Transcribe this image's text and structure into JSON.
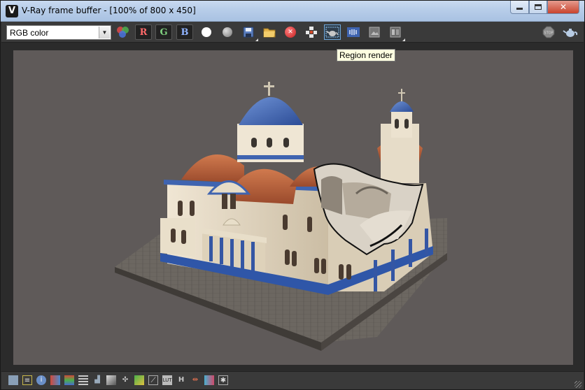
{
  "window": {
    "title": "V-Ray frame buffer - [100% of 800 x 450]",
    "app_icon": "vray-logo-icon"
  },
  "toolbar": {
    "channel_value": "RGB color",
    "buttons": [
      {
        "name": "rgb-channels-button",
        "icon": "rgb-circles-icon"
      },
      {
        "name": "red-channel-button",
        "label": "R"
      },
      {
        "name": "green-channel-button",
        "label": "G"
      },
      {
        "name": "blue-channel-button",
        "label": "B"
      },
      {
        "name": "white-alpha-button",
        "icon": "white-circle-icon"
      },
      {
        "name": "mono-button",
        "icon": "grey-circle-icon"
      },
      {
        "name": "save-image-button",
        "icon": "floppy-disk-icon"
      },
      {
        "name": "load-image-button",
        "icon": "folder-icon"
      },
      {
        "name": "clear-image-button",
        "icon": "red-x-icon"
      },
      {
        "name": "follow-mouse-button",
        "icon": "grid-cross-icon"
      },
      {
        "name": "region-render-button",
        "icon": "teapot-region-icon",
        "selected": true
      },
      {
        "name": "link-to-vfb-button",
        "icon": "film-strip-icon"
      },
      {
        "name": "history-button",
        "icon": "image-icon"
      },
      {
        "name": "compare-button",
        "icon": "ab-compare-icon"
      },
      {
        "name": "stop-render-button",
        "icon": "stop-sign-icon"
      },
      {
        "name": "render-button",
        "icon": "teapot-icon"
      }
    ],
    "region_render_tooltip": "Region render",
    "stop_label": "STOP"
  },
  "statusbar": {
    "buttons": [
      "render-last-icon",
      "history-icon",
      "info-icon",
      "color-correct-icon",
      "lut-icon",
      "levels-icon",
      "histogram-icon",
      "curves-icon",
      "exposure-icon",
      "sRGB-icon",
      "ocio-icon",
      "curve-icon",
      "lut-file-icon",
      "H",
      "pixel-aspect-icon",
      "display-correction-icon",
      "star-icon"
    ]
  },
  "colors": {
    "window_bg": "#2b2b2b",
    "toolbar_bg": "#3a3a3a",
    "render_bg": "#5f5a59",
    "dome_blue": "#3f64b0",
    "roof_orange": "#b8603a",
    "wall_cream": "#e4d8c2"
  }
}
